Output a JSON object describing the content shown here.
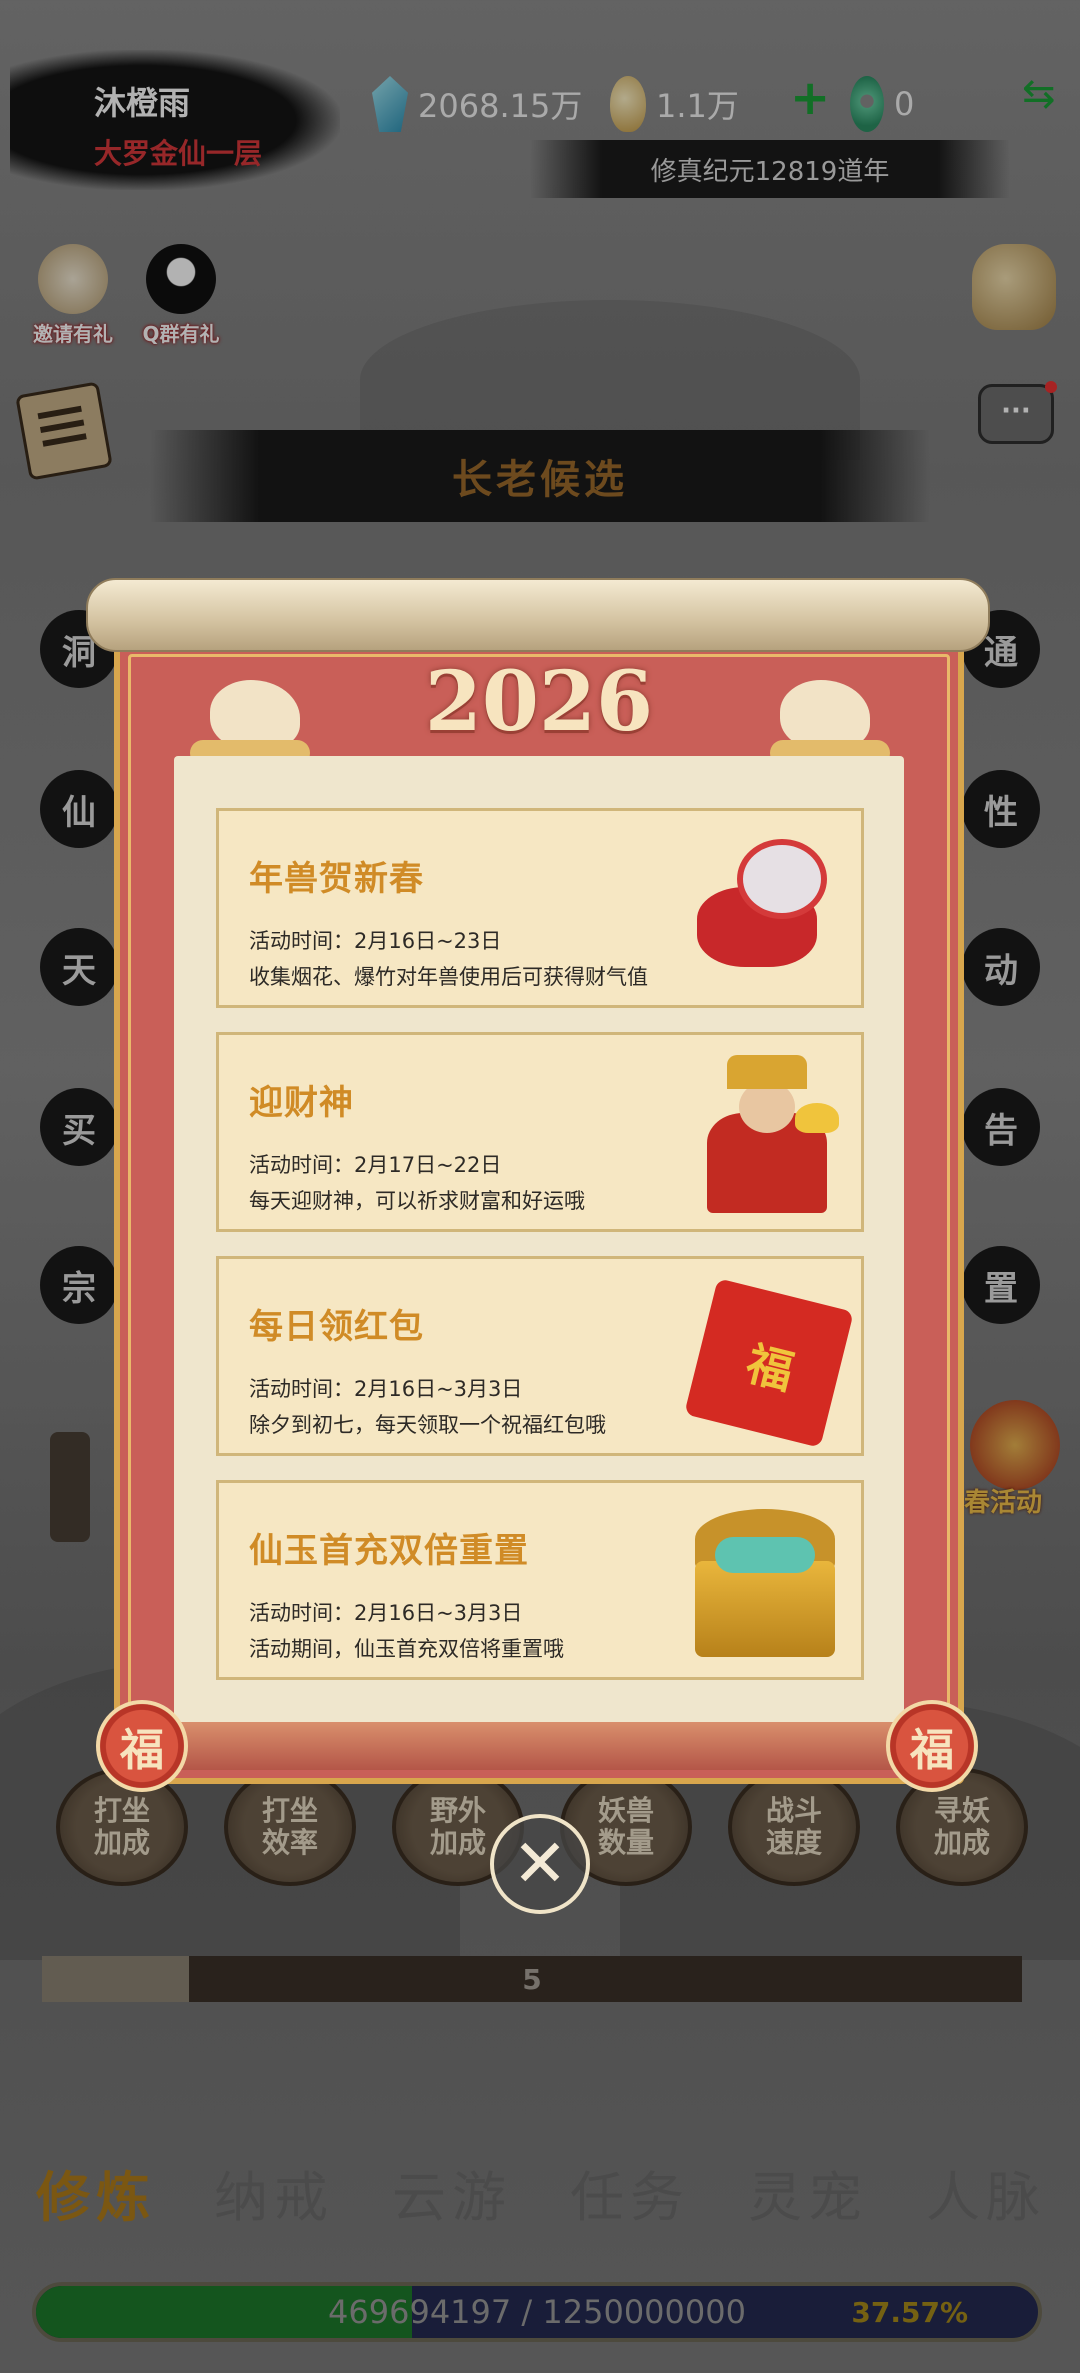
{
  "player": {
    "name": "沐橙雨",
    "rank": "大罗金仙一层"
  },
  "resources": {
    "spirit_stones": "2068.15万",
    "coins": "1.1万",
    "jade": "0"
  },
  "era": "修真纪元12819道年",
  "badges": {
    "invite": "邀请有礼",
    "qq_group": "Q群有礼"
  },
  "banner": {
    "elder_candidates": "长老候选"
  },
  "side_chars": [
    "洞",
    "仙",
    "天",
    "买",
    "宗",
    "通",
    "性",
    "动",
    "告",
    "置"
  ],
  "spring_event": "春活动",
  "boosts": [
    {
      "line1": "打坐",
      "line2": "加成"
    },
    {
      "line1": "打坐",
      "line2": "效率"
    },
    {
      "line1": "野外",
      "line2": "加成"
    },
    {
      "line1": "妖兽",
      "line2": "数量"
    },
    {
      "line1": "战斗",
      "line2": "速度"
    },
    {
      "line1": "寻妖",
      "line2": "加成"
    }
  ],
  "stage_progress": {
    "label": "5",
    "fraction": 0.15
  },
  "tabs": [
    {
      "label": "修炼",
      "active": true
    },
    {
      "label": "纳戒",
      "active": false
    },
    {
      "label": "云游",
      "active": false
    },
    {
      "label": "任务",
      "active": false
    },
    {
      "label": "灵宠",
      "active": false
    },
    {
      "label": "人脉",
      "active": false
    }
  ],
  "experience": {
    "value_text": "469694197 / 1250000000",
    "percent_text": "37.57%",
    "fraction": 0.3757
  },
  "modal": {
    "year": "2026",
    "seal": "福",
    "events": [
      {
        "title": "年兽贺新春",
        "time": "活动时间：2月16日~23日",
        "desc": "收集烟花、爆竹对年兽使用后可获得财气值",
        "art": "nian-beast-icon"
      },
      {
        "title": "迎财神",
        "time": "活动时间：2月17日~22日",
        "desc": "每天迎财神，可以祈求财富和好运哦",
        "art": "god-of-wealth-icon"
      },
      {
        "title": "每日领红包",
        "time": "活动时间：2月16日~3月3日",
        "desc": "除夕到初七，每天领取一个祝福红包哦",
        "art": "red-envelope-icon"
      },
      {
        "title": "仙玉首充双倍重置",
        "time": "活动时间：2月16日~3月3日",
        "desc": "活动期间，仙玉首充双倍将重置哦",
        "art": "treasure-chest-icon"
      }
    ],
    "envelope_char": "福"
  },
  "colors": {
    "accent_gold": "#d08b26",
    "scroll_red": "#c95f58",
    "rank_red": "#d8393b",
    "plus_green": "#1aa037"
  }
}
